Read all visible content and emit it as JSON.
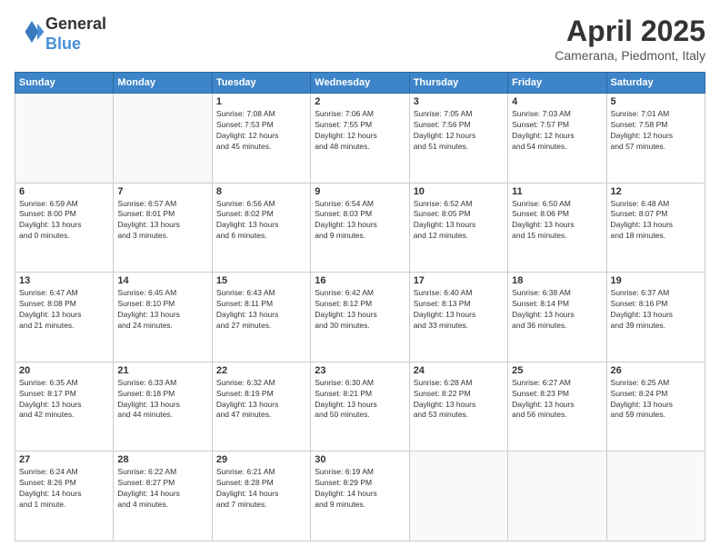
{
  "header": {
    "logo_line1": "General",
    "logo_line2": "Blue",
    "title": "April 2025",
    "subtitle": "Camerana, Piedmont, Italy"
  },
  "weekdays": [
    "Sunday",
    "Monday",
    "Tuesday",
    "Wednesday",
    "Thursday",
    "Friday",
    "Saturday"
  ],
  "weeks": [
    [
      {
        "day": "",
        "info": ""
      },
      {
        "day": "",
        "info": ""
      },
      {
        "day": "1",
        "info": "Sunrise: 7:08 AM\nSunset: 7:53 PM\nDaylight: 12 hours\nand 45 minutes."
      },
      {
        "day": "2",
        "info": "Sunrise: 7:06 AM\nSunset: 7:55 PM\nDaylight: 12 hours\nand 48 minutes."
      },
      {
        "day": "3",
        "info": "Sunrise: 7:05 AM\nSunset: 7:56 PM\nDaylight: 12 hours\nand 51 minutes."
      },
      {
        "day": "4",
        "info": "Sunrise: 7:03 AM\nSunset: 7:57 PM\nDaylight: 12 hours\nand 54 minutes."
      },
      {
        "day": "5",
        "info": "Sunrise: 7:01 AM\nSunset: 7:58 PM\nDaylight: 12 hours\nand 57 minutes."
      }
    ],
    [
      {
        "day": "6",
        "info": "Sunrise: 6:59 AM\nSunset: 8:00 PM\nDaylight: 13 hours\nand 0 minutes."
      },
      {
        "day": "7",
        "info": "Sunrise: 6:57 AM\nSunset: 8:01 PM\nDaylight: 13 hours\nand 3 minutes."
      },
      {
        "day": "8",
        "info": "Sunrise: 6:56 AM\nSunset: 8:02 PM\nDaylight: 13 hours\nand 6 minutes."
      },
      {
        "day": "9",
        "info": "Sunrise: 6:54 AM\nSunset: 8:03 PM\nDaylight: 13 hours\nand 9 minutes."
      },
      {
        "day": "10",
        "info": "Sunrise: 6:52 AM\nSunset: 8:05 PM\nDaylight: 13 hours\nand 12 minutes."
      },
      {
        "day": "11",
        "info": "Sunrise: 6:50 AM\nSunset: 8:06 PM\nDaylight: 13 hours\nand 15 minutes."
      },
      {
        "day": "12",
        "info": "Sunrise: 6:48 AM\nSunset: 8:07 PM\nDaylight: 13 hours\nand 18 minutes."
      }
    ],
    [
      {
        "day": "13",
        "info": "Sunrise: 6:47 AM\nSunset: 8:08 PM\nDaylight: 13 hours\nand 21 minutes."
      },
      {
        "day": "14",
        "info": "Sunrise: 6:45 AM\nSunset: 8:10 PM\nDaylight: 13 hours\nand 24 minutes."
      },
      {
        "day": "15",
        "info": "Sunrise: 6:43 AM\nSunset: 8:11 PM\nDaylight: 13 hours\nand 27 minutes."
      },
      {
        "day": "16",
        "info": "Sunrise: 6:42 AM\nSunset: 8:12 PM\nDaylight: 13 hours\nand 30 minutes."
      },
      {
        "day": "17",
        "info": "Sunrise: 6:40 AM\nSunset: 8:13 PM\nDaylight: 13 hours\nand 33 minutes."
      },
      {
        "day": "18",
        "info": "Sunrise: 6:38 AM\nSunset: 8:14 PM\nDaylight: 13 hours\nand 36 minutes."
      },
      {
        "day": "19",
        "info": "Sunrise: 6:37 AM\nSunset: 8:16 PM\nDaylight: 13 hours\nand 39 minutes."
      }
    ],
    [
      {
        "day": "20",
        "info": "Sunrise: 6:35 AM\nSunset: 8:17 PM\nDaylight: 13 hours\nand 42 minutes."
      },
      {
        "day": "21",
        "info": "Sunrise: 6:33 AM\nSunset: 8:18 PM\nDaylight: 13 hours\nand 44 minutes."
      },
      {
        "day": "22",
        "info": "Sunrise: 6:32 AM\nSunset: 8:19 PM\nDaylight: 13 hours\nand 47 minutes."
      },
      {
        "day": "23",
        "info": "Sunrise: 6:30 AM\nSunset: 8:21 PM\nDaylight: 13 hours\nand 50 minutes."
      },
      {
        "day": "24",
        "info": "Sunrise: 6:28 AM\nSunset: 8:22 PM\nDaylight: 13 hours\nand 53 minutes."
      },
      {
        "day": "25",
        "info": "Sunrise: 6:27 AM\nSunset: 8:23 PM\nDaylight: 13 hours\nand 56 minutes."
      },
      {
        "day": "26",
        "info": "Sunrise: 6:25 AM\nSunset: 8:24 PM\nDaylight: 13 hours\nand 59 minutes."
      }
    ],
    [
      {
        "day": "27",
        "info": "Sunrise: 6:24 AM\nSunset: 8:26 PM\nDaylight: 14 hours\nand 1 minute."
      },
      {
        "day": "28",
        "info": "Sunrise: 6:22 AM\nSunset: 8:27 PM\nDaylight: 14 hours\nand 4 minutes."
      },
      {
        "day": "29",
        "info": "Sunrise: 6:21 AM\nSunset: 8:28 PM\nDaylight: 14 hours\nand 7 minutes."
      },
      {
        "day": "30",
        "info": "Sunrise: 6:19 AM\nSunset: 8:29 PM\nDaylight: 14 hours\nand 9 minutes."
      },
      {
        "day": "",
        "info": ""
      },
      {
        "day": "",
        "info": ""
      },
      {
        "day": "",
        "info": ""
      }
    ]
  ]
}
